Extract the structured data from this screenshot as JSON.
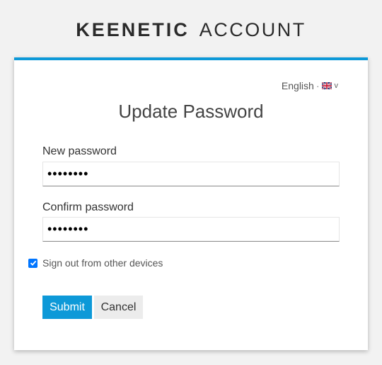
{
  "brand": {
    "name": "KEENETIC",
    "suffix": "ACCOUNT"
  },
  "language": {
    "selected": "English",
    "separator": "·",
    "flag_icon": "uk-flag-icon",
    "chevron": "v"
  },
  "form": {
    "title": "Update Password",
    "new_password": {
      "label": "New password",
      "value": "••••••••"
    },
    "confirm_password": {
      "label": "Confirm password",
      "value": "••••••••"
    },
    "sign_out_checkbox": {
      "label": "Sign out from other devices",
      "checked": true
    },
    "submit_label": "Submit",
    "cancel_label": "Cancel"
  },
  "colors": {
    "accent": "#0d99d8",
    "checkbox": "#0075ff",
    "background": "#f2f2f2"
  }
}
